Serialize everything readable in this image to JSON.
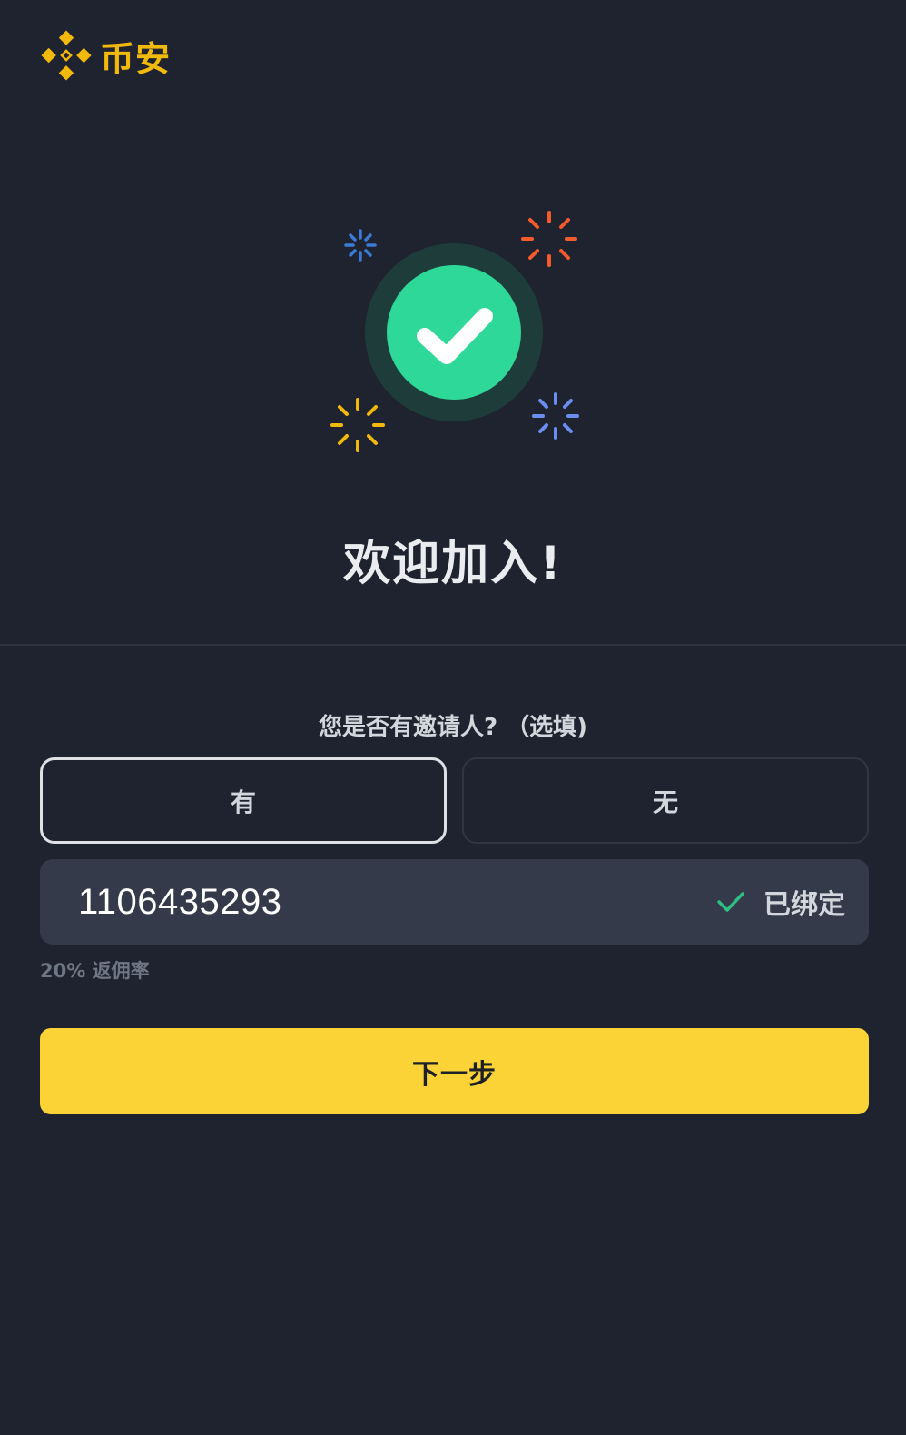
{
  "brand": {
    "logo_icon": "binance-logo-icon",
    "name": "币安",
    "color": "#f0b90b"
  },
  "hero": {
    "icon": "success-check-icon",
    "ring_color": "#1e3d3a",
    "check_color": "#2ed898",
    "sparkle_colors": [
      "#3a7bd5",
      "#f45b2c",
      "#f0b90b",
      "#6b8ef0"
    ]
  },
  "welcome_title": "欢迎加入!",
  "referral_question": "您是否有邀请人? （选填)",
  "choices": {
    "yes_label": "有",
    "no_label": "无",
    "selected": "yes"
  },
  "referral_field": {
    "value": "1106435293",
    "status_icon": "check-icon",
    "status_color": "#2ebd85",
    "status_label": "已绑定"
  },
  "rebate_text": "20% 返佣率",
  "next_button": {
    "label": "下一步",
    "color": "#fbd336"
  }
}
